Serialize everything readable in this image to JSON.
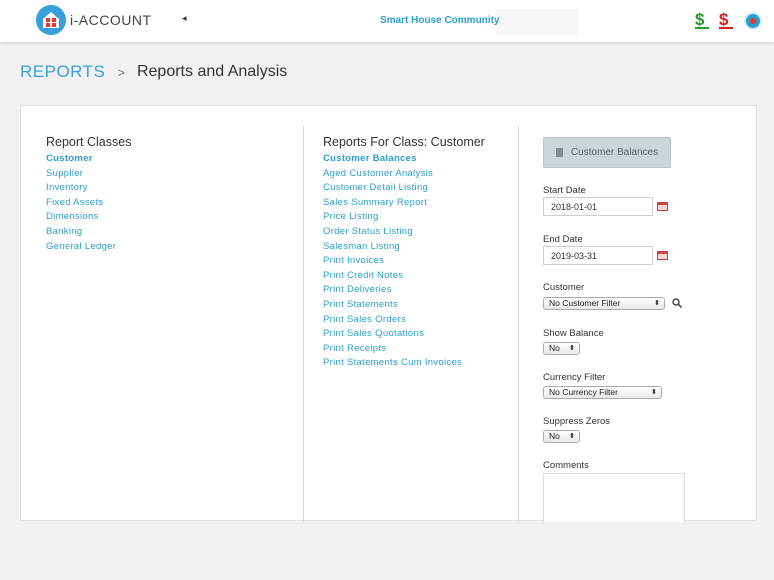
{
  "header": {
    "logo_text": "i-ACCOUNT",
    "collapse_icon": "◂",
    "company": "Smart House Community",
    "icon_receive": "$",
    "icon_pay": "$"
  },
  "breadcrumb": {
    "root": "REPORTS",
    "separator": ">",
    "current": "Reports and Analysis"
  },
  "report_classes": {
    "heading": "Report Classes",
    "items": [
      "Customer",
      "Supplier",
      "Inventory",
      "Fixed Assets",
      "Dimensions",
      "Banking",
      "General Ledger"
    ]
  },
  "reports": {
    "heading": "Reports For Class:  Customer",
    "items": [
      "Customer Balances",
      "Aged Customer Analysis",
      "Customer Detail Listing",
      "Sales Summary Report",
      "Price Listing",
      "Order Status Listing",
      "Salesman Listing",
      "Print Invoices",
      "Print Credit Notes",
      "Print Deliveries",
      "Print Statements",
      "Print Sales Orders",
      "Print Sales Quotations",
      "Print Receipts",
      "Print Statements Cum Invoices"
    ]
  },
  "form": {
    "button_label": "Customer Balances",
    "start_date_label": "Start Date",
    "start_date": "2018-01-01",
    "end_date_label": "End Date",
    "end_date": "2019-03-31",
    "customer_label": "Customer",
    "customer_value": "No Customer Filter",
    "show_balance_label": "Show Balance",
    "show_balance_value": "No",
    "currency_label": "Currency Filter",
    "currency_value": "No Currency Filter",
    "suppress_label": "Suppress Zeros",
    "suppress_value": "No",
    "comments_label": "Comments"
  },
  "colors": {
    "accent": "#2aa0d0",
    "brand": "#3aa0d9",
    "receive": "#2a9a2a",
    "pay": "#d42020"
  }
}
